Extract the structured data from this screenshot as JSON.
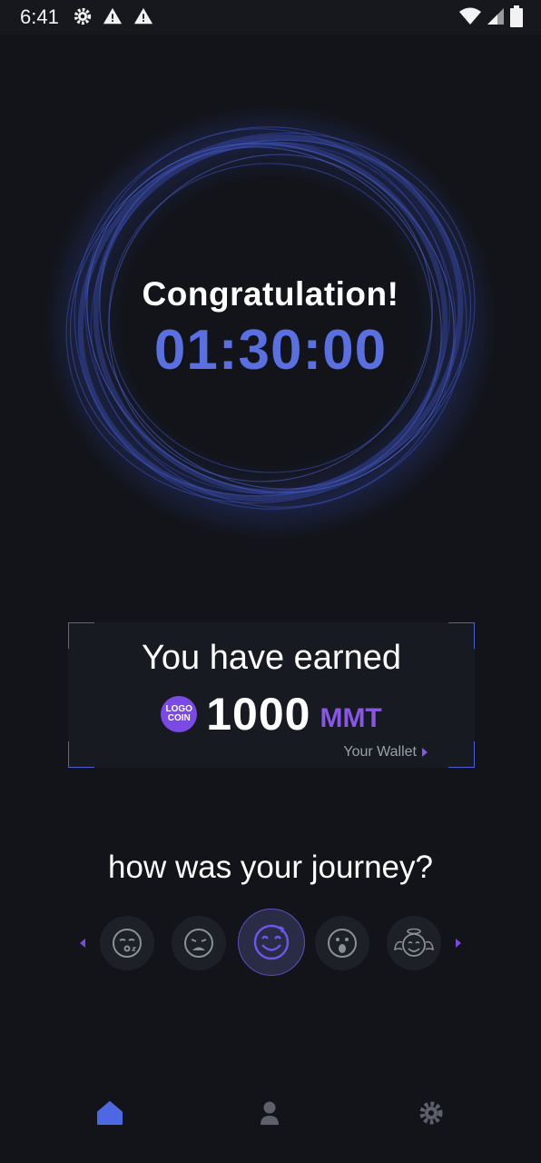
{
  "status_bar": {
    "time": "6:41",
    "icons": [
      "gear-icon",
      "warning-icon",
      "warning-icon",
      "wifi-icon",
      "signal-icon",
      "battery-icon"
    ]
  },
  "session": {
    "title": "Congratulation!",
    "timer": "01:30:00"
  },
  "earned": {
    "title": "You have earned",
    "coin_line1": "LOGO",
    "coin_line2": "COIN",
    "amount": "1000",
    "currency": "MMT",
    "wallet_link": "Your Wallet"
  },
  "journey": {
    "title": "how was your journey?",
    "moods": [
      "sleepy-face-icon",
      "sad-face-icon",
      "happy-face-icon",
      "surprised-face-icon",
      "angel-face-icon"
    ],
    "selected_index": 2
  },
  "nav": {
    "items": [
      "home-icon",
      "profile-icon",
      "settings-icon"
    ],
    "active": "home-icon"
  },
  "colors": {
    "background": "#121419",
    "accent_blue": "#5a6fe0",
    "accent_purple": "#8a56e6"
  }
}
